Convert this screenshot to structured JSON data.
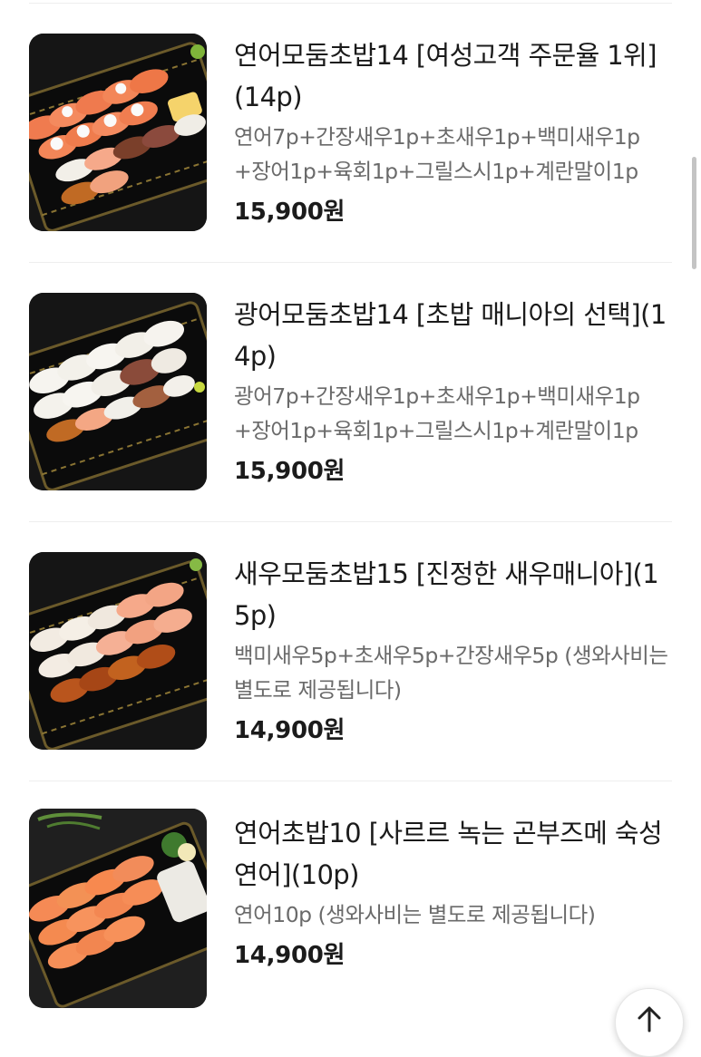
{
  "menu": {
    "items": [
      {
        "name": "연어모둠초밥14 [여성고객 주문율 1위](14p)",
        "description": "연어7p+간장새우1p+초새우1p+백미새우1p+장어1p+육회1p+그릴스시1p+계란말이1p",
        "price": "15,900원",
        "image": "salmon-assorted-sushi-photo"
      },
      {
        "name": "광어모둠초밥14 [초밥 매니아의 선택](14p)",
        "description": "광어7p+간장새우1p+초새우1p+백미새우1p+장어1p+육회1p+그릴스시1p+계란말이1p",
        "price": "15,900원",
        "image": "flatfish-assorted-sushi-photo"
      },
      {
        "name": "새우모둠초밥15 [진정한 새우매니아](15p)",
        "description": "백미새우5p+초새우5p+간장새우5p (생와사비는 별도로 제공됩니다)",
        "price": "14,900원",
        "image": "shrimp-assorted-sushi-photo"
      },
      {
        "name": "연어초밥10 [사르르 녹는 곤부즈메 숙성연어](10p)",
        "description": "연어10p (생와사비는 별도로 제공됩니다)",
        "price": "14,900원",
        "image": "salmon-sushi-photo"
      }
    ]
  },
  "scroll_top": {
    "icon": "arrow-up-icon"
  }
}
